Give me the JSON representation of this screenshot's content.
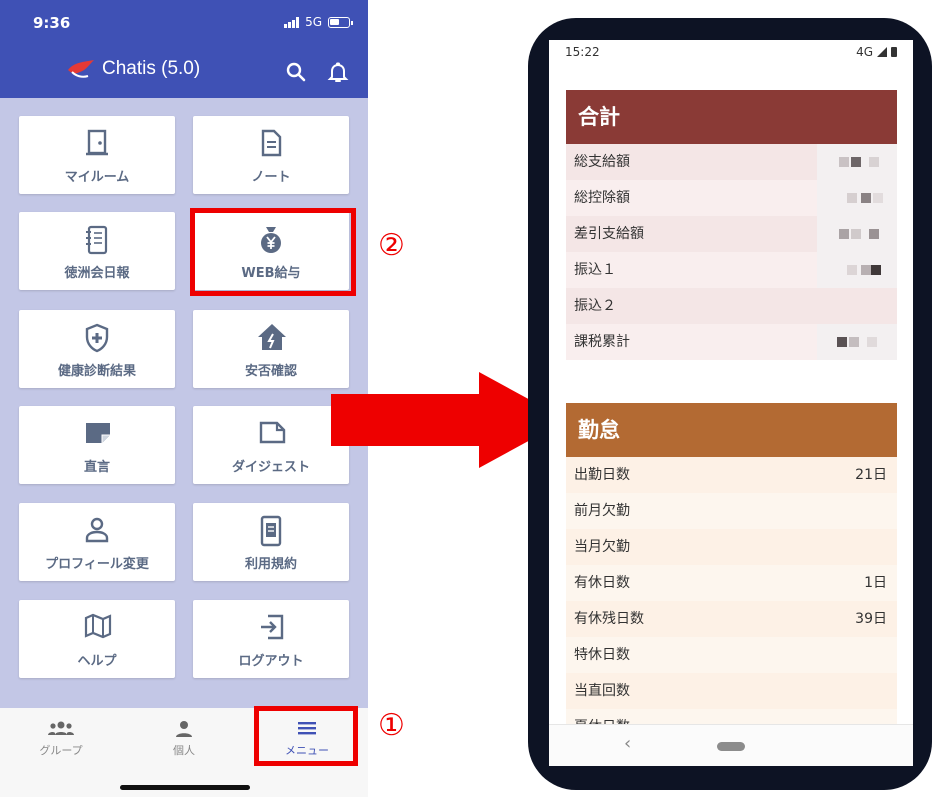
{
  "left_phone": {
    "status": {
      "time": "9:36",
      "network": "5G"
    },
    "app_title": "Chatis (5.0)",
    "icons": {
      "search": "search-icon",
      "bell": "bell-icon",
      "logo": "bird-logo-icon"
    },
    "tiles": [
      {
        "label": "マイルーム",
        "icon": "door-icon"
      },
      {
        "label": "ノート",
        "icon": "document-icon"
      },
      {
        "label": "徳洲会日報",
        "icon": "notebook-icon"
      },
      {
        "label": "WEB給与",
        "icon": "money-bag-yen-icon"
      },
      {
        "label": "健康診断結果",
        "icon": "shield-plus-icon"
      },
      {
        "label": "安否確認",
        "icon": "house-alert-icon"
      },
      {
        "label": "直言",
        "icon": "folded-note-icon"
      },
      {
        "label": "ダイジェスト",
        "icon": "folder-outline-icon"
      },
      {
        "label": "プロフィール変更",
        "icon": "person-icon"
      },
      {
        "label": "利用規約",
        "icon": "phone-doc-icon"
      },
      {
        "label": "ヘルプ",
        "icon": "map-icon"
      },
      {
        "label": "ログアウト",
        "icon": "logout-icon"
      }
    ],
    "bottom_nav": [
      {
        "label": "グループ",
        "icon": "group-icon"
      },
      {
        "label": "個人",
        "icon": "person-icon"
      },
      {
        "label": "メニュー",
        "icon": "menu-icon"
      }
    ]
  },
  "annotations": {
    "step1": "①",
    "step2": "②"
  },
  "colors": {
    "header": "#3f51b5",
    "highlight": "#ee0000",
    "total_header": "#8a3a36",
    "attendance_header": "#b36a33"
  },
  "right_phone": {
    "status": {
      "time": "15:22",
      "network": "4G"
    },
    "total_section": {
      "title": "合計",
      "rows": [
        {
          "label": "総支給額",
          "value": ""
        },
        {
          "label": "総控除額",
          "value": ""
        },
        {
          "label": "差引支給額",
          "value": ""
        },
        {
          "label": "振込１",
          "value": ""
        },
        {
          "label": "振込２",
          "value": ""
        },
        {
          "label": "課税累計",
          "value": ""
        }
      ]
    },
    "attendance_section": {
      "title": "勤怠",
      "rows": [
        {
          "label": "出勤日数",
          "value": "21日"
        },
        {
          "label": "前月欠勤",
          "value": ""
        },
        {
          "label": "当月欠勤",
          "value": ""
        },
        {
          "label": "有休日数",
          "value": "1日"
        },
        {
          "label": "有休残日数",
          "value": "39日"
        },
        {
          "label": "特休日数",
          "value": ""
        },
        {
          "label": "当直回数",
          "value": ""
        },
        {
          "label": "夏休日数",
          "value": ""
        }
      ]
    },
    "nav": {
      "back": "‹"
    }
  }
}
